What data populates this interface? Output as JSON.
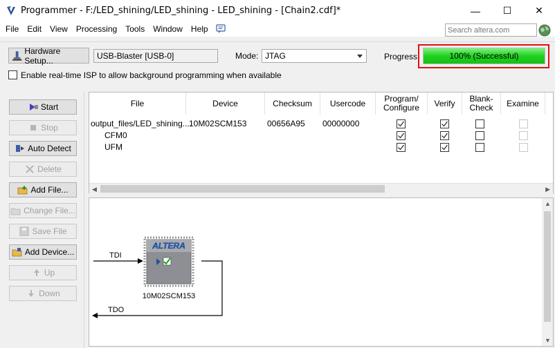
{
  "window": {
    "title": "Programmer - F:/LED_shining/LED_shining - LED_shining - [Chain2.cdf]*",
    "minimize": "—",
    "maximize": "☐",
    "close": "✕"
  },
  "menu": {
    "items": [
      "File",
      "Edit",
      "View",
      "Processing",
      "Tools",
      "Window",
      "Help"
    ],
    "search_placeholder": "Search altera.com"
  },
  "toolbar": {
    "hardware_setup_label": "Hardware Setup...",
    "hardware_value": "USB-Blaster [USB-0]",
    "mode_label": "Mode:",
    "mode_value": "JTAG",
    "progress_label": "Progress:",
    "progress_text": "100% (Successful)",
    "progress_percent": 100,
    "progress_color": "#21d121",
    "isp_label": "Enable real-time ISP to allow background programming when available",
    "isp_checked": false
  },
  "side_buttons": [
    {
      "label": "Start",
      "enabled": true,
      "icon": "start-icon"
    },
    {
      "label": "Stop",
      "enabled": false,
      "icon": "stop-icon"
    },
    {
      "label": "Auto Detect",
      "enabled": true,
      "icon": "auto-detect-icon"
    },
    {
      "label": "Delete",
      "enabled": false,
      "icon": "delete-icon"
    },
    {
      "label": "Add File...",
      "enabled": true,
      "icon": "add-file-icon"
    },
    {
      "label": "Change File...",
      "enabled": false,
      "icon": "change-file-icon"
    },
    {
      "label": "Save File",
      "enabled": false,
      "icon": "save-file-icon"
    },
    {
      "label": "Add Device...",
      "enabled": true,
      "icon": "add-device-icon"
    },
    {
      "label": "Up",
      "enabled": false,
      "icon": "up-icon"
    },
    {
      "label": "Down",
      "enabled": false,
      "icon": "down-icon"
    }
  ],
  "table": {
    "headers": {
      "file": "File",
      "device": "Device",
      "checksum": "Checksum",
      "usercode": "Usercode",
      "program": "Program/\nConfigure",
      "verify": "Verify",
      "blank_check": "Blank-\nCheck",
      "examine": "Examine"
    },
    "rows": [
      {
        "file": "output_files/LED_shining....",
        "device": "10M02SCM153",
        "checksum": "00656A95",
        "usercode": "00000000",
        "program": true,
        "verify": true,
        "blank": false,
        "examine": false
      },
      {
        "file": "CFM0",
        "device": "",
        "checksum": "",
        "usercode": "",
        "program": true,
        "verify": true,
        "blank": false,
        "examine": false
      },
      {
        "file": "UFM",
        "device": "",
        "checksum": "",
        "usercode": "",
        "program": true,
        "verify": true,
        "blank": false,
        "examine": false
      }
    ]
  },
  "chain": {
    "tdi_label": "TDI",
    "tdo_label": "TDO",
    "chip_logo": "ALTERA",
    "device_name": "10M02SCM153"
  }
}
